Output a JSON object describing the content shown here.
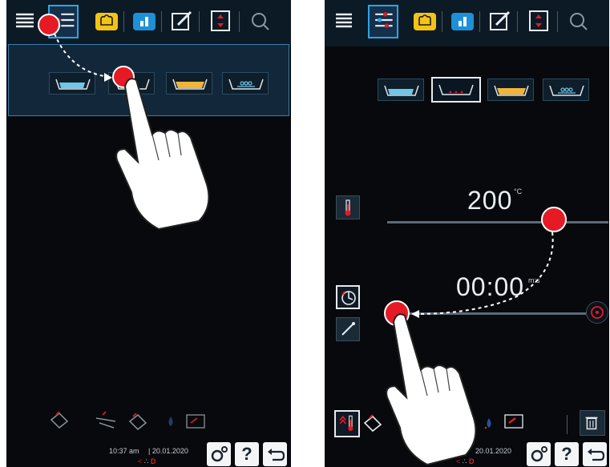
{
  "left_panel": {
    "tabs": [
      "menu-icon",
      "filter-icon",
      "chef-hat-icon",
      "bar-chart-icon",
      "edit-icon",
      "updown-icon",
      "search-icon"
    ],
    "categories": [
      "water-tray-icon",
      "red-dots-tray-icon",
      "yellow-tray-icon",
      "steam-tray-icon"
    ],
    "status": {
      "time": "10:37 am",
      "date": "20.01.2020"
    }
  },
  "right_panel": {
    "tabs": [
      "menu-icon",
      "filter-icon",
      "chef-hat-icon",
      "bar-chart-icon",
      "edit-icon",
      "updown-icon",
      "search-icon"
    ],
    "categories": [
      "water-tray-icon",
      "red-dots-tray-icon",
      "yellow-tray-icon",
      "steam-tray-icon"
    ],
    "temperature": {
      "value": "200",
      "unit": "°C"
    },
    "time": {
      "value": "00:00",
      "unit": "m:s"
    },
    "status": {
      "date": "20.01.2020"
    }
  },
  "colors": {
    "accent_red": "#e51a24",
    "accent_blue": "#2aa6e6",
    "panel_bg": "#07090c",
    "tab_yellow": "#f2c416"
  }
}
